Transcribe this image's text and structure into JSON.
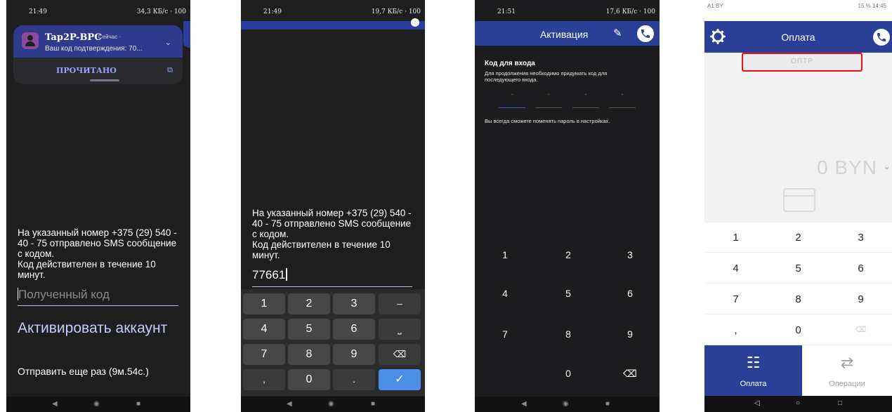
{
  "colors": {
    "brand_blue": "#2a3f97",
    "highlight_red": "#ee1111",
    "link_lavender": "#c4ccff"
  },
  "nav": {
    "back": "◀",
    "home": "◉",
    "recent": "■",
    "back_outline": "◁",
    "home_outline": "○",
    "recent_outline": "□"
  },
  "screen1": {
    "status": {
      "time": "21:49",
      "network": "34,3 КБ/с · 100"
    },
    "notification": {
      "app": "Tap2P-BPC",
      "meta": "· Сейчас ·",
      "body": "Ваш код подтверждения: 70...",
      "action": "ПРОЧИТАНО"
    },
    "message": "На указанный номер +375 (29) 540 -\n40 - 75 отправлено SMS сообщение\nс кодом.\nКод действителен в течение 10\nминут.",
    "code_placeholder": "Полученный код",
    "activate_label": "Активировать аккаунт",
    "resend_label": "Отправить еще раз (9м.54с.)"
  },
  "screen2": {
    "status": {
      "time": "21:49",
      "network": "19,7 КБ/с · 100"
    },
    "message": "На указанный номер +375 (29) 540 -\n40 - 75 отправлено SMS сообщение\nс кодом.\nКод действителен в течение 10\nминут.",
    "code_value": "77661",
    "keys": [
      "1",
      "2",
      "3",
      "–",
      "4",
      "5",
      "6",
      "⎵",
      "7",
      "8",
      "9",
      "⌫",
      ",",
      "0",
      ".",
      "✓"
    ]
  },
  "screen3": {
    "status": {
      "time": "21:51",
      "network": "17,6 КБ/с · 100"
    },
    "title": "Активация",
    "section_title": "Код для входа",
    "hint": "Для продолжения необходимо придумать код для последующего входа.",
    "note": "Вы всегда сможете поменять пароль в настройках.",
    "pin_slots": [
      "-",
      "-",
      "-",
      "-"
    ],
    "keys": [
      "1",
      "2",
      "3",
      "4",
      "5",
      "6",
      "7",
      "8",
      "9",
      "",
      "0",
      "⌫"
    ]
  },
  "screen4": {
    "status": {
      "left": "A1 BY",
      "right": "15 %  14:45"
    },
    "title": "Оплата",
    "otp_label": "ОПТР",
    "amount": "0 BYN",
    "keys": [
      "1",
      "2",
      "3",
      "4",
      "5",
      "6",
      "7",
      "8",
      "9",
      ",",
      "0",
      "⌫"
    ],
    "tabs": [
      {
        "label": "Оплата",
        "icon": "receipt-icon"
      },
      {
        "label": "Операции",
        "icon": "transfer-arrows-icon"
      }
    ]
  }
}
